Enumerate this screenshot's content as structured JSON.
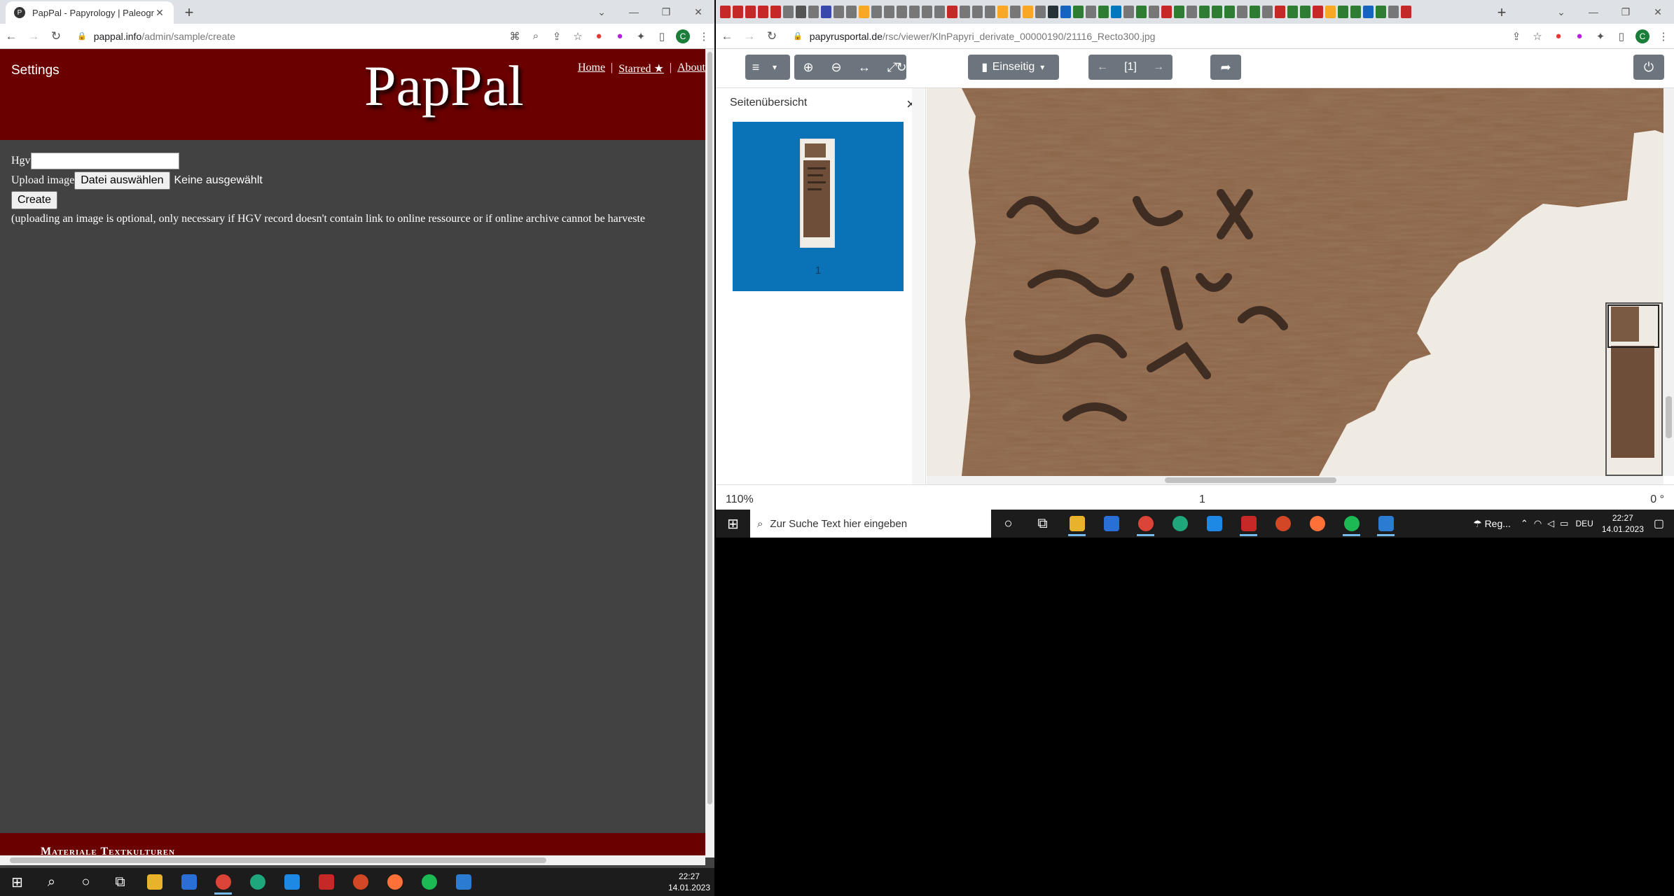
{
  "left_browser": {
    "tab_title": "PapPal - Papyrology | Paleograph",
    "url_domain": "pappal.info",
    "url_path": "/admin/sample/create",
    "profile_initial": "C"
  },
  "pappal": {
    "settings_label": "Settings",
    "logo": "PapPal",
    "nav": {
      "home": "Home",
      "starred": "Starred ★",
      "about": "About",
      "sep": "|"
    },
    "form": {
      "hgv_label": "Hgv",
      "hgv_value": "",
      "upload_label": "Upload image",
      "choose_file_button": "Datei auswählen",
      "no_file_text": "Keine ausgewählt",
      "create_button": "Create",
      "note": "(uploading an image is optional, only necessary if HGV record doesn't contain link to online ressource or if online archive cannot be harveste"
    },
    "footer_text": "Materiale Textkulturen"
  },
  "right_browser": {
    "url_domain": "papyrusportal.de",
    "url_path": "/rsc/viewer/KlnPapyri_derivate_00000190/21116_Recto300.jpg",
    "profile_initial": "C"
  },
  "viewer": {
    "layout_button": "Einseitig",
    "page_indicator": "[1]",
    "sidebar_title": "Seitenübersicht",
    "thumbnail_number": "1",
    "zoom": "110%",
    "page_status": "1",
    "rotation": "0 °"
  },
  "taskbar_right": {
    "search_placeholder": "Zur Suche Text hier eingeben",
    "weather": "Reg...",
    "language": "DEU",
    "time": "22:27",
    "date": "14.01.2023"
  },
  "taskbar_left": {
    "time": "22:27",
    "date": "14.01.2023"
  },
  "colors": {
    "header_red": "#6a0000",
    "page_bg": "#424242",
    "thumb_card": "#0a73b8"
  }
}
